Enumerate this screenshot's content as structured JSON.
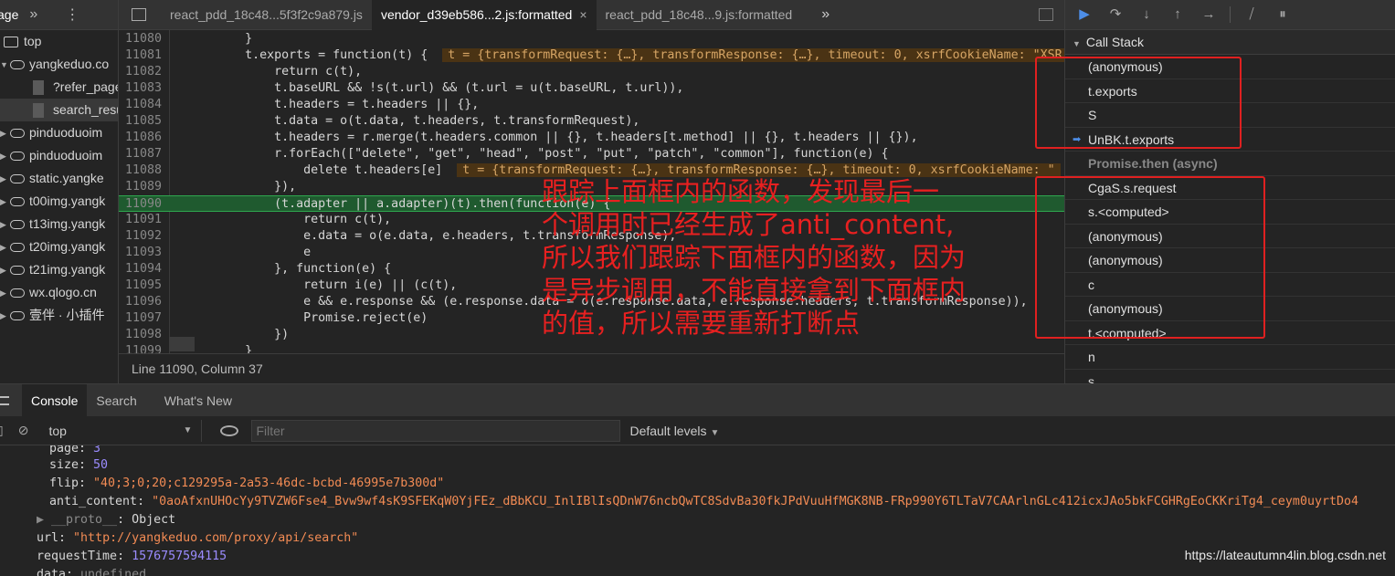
{
  "left_panel": {
    "tab_label": "age",
    "items": [
      {
        "type": "folder",
        "label": "top"
      },
      {
        "type": "cloud",
        "label": "yangkeduo.co",
        "expanded": true
      },
      {
        "type": "file",
        "label": "?refer_page"
      },
      {
        "type": "file",
        "label": "search_resu",
        "selected": true
      },
      {
        "type": "cloud",
        "label": "pinduoduoim"
      },
      {
        "type": "cloud",
        "label": "pinduoduoim"
      },
      {
        "type": "cloud",
        "label": "static.yangke"
      },
      {
        "type": "cloud",
        "label": "t00img.yangk"
      },
      {
        "type": "cloud",
        "label": "t13img.yangk"
      },
      {
        "type": "cloud",
        "label": "t20img.yangk"
      },
      {
        "type": "cloud",
        "label": "t21img.yangk"
      },
      {
        "type": "cloud",
        "label": "wx.qlogo.cn"
      },
      {
        "type": "cloud",
        "label": "壹伴 · 小插件"
      }
    ]
  },
  "file_tabs": [
    {
      "label": "react_pdd_18c48...5f3f2c9a879.js",
      "active": false
    },
    {
      "label": "vendor_d39eb586...2.js:formatted",
      "active": true,
      "close": "×"
    },
    {
      "label": "react_pdd_18c48...9.js:formatted",
      "active": false
    }
  ],
  "editor": {
    "lines": [
      {
        "num": "11080",
        "code": "        }"
      },
      {
        "num": "11081",
        "code": "        t.exports = function(t) {",
        "inline": "t = {transformRequest: {…}, transformResponse: {…}, timeout: 0, xsrfCookieName: \"XSR"
      },
      {
        "num": "11082",
        "code": "            return c(t),"
      },
      {
        "num": "11083",
        "code": "            t.baseURL && !s(t.url) && (t.url = u(t.baseURL, t.url)),"
      },
      {
        "num": "11084",
        "code": "            t.headers = t.headers || {},"
      },
      {
        "num": "11085",
        "code": "            t.data = o(t.data, t.headers, t.transformRequest),"
      },
      {
        "num": "11086",
        "code": "            t.headers = r.merge(t.headers.common || {}, t.headers[t.method] || {}, t.headers || {}),"
      },
      {
        "num": "11087",
        "code": "            r.forEach([\"delete\", \"get\", \"head\", \"post\", \"put\", \"patch\", \"common\"], function(e) {"
      },
      {
        "num": "11088",
        "code": "                delete t.headers[e]",
        "inline": "t = {transformRequest: {…}, transformResponse: {…}, timeout: 0, xsrfCookieName: \""
      },
      {
        "num": "11089",
        "code": "            }),"
      },
      {
        "num": "11090",
        "code": "            (t.adapter || a.adapter)(t).then(function(e) {",
        "highlight": true
      },
      {
        "num": "11091",
        "code": "                return c(t),"
      },
      {
        "num": "11092",
        "code": "                e.data = o(e.data, e.headers, t.transformResponse),"
      },
      {
        "num": "11093",
        "code": "                e"
      },
      {
        "num": "11094",
        "code": "            }, function(e) {"
      },
      {
        "num": "11095",
        "code": "                return i(e) || (c(t),"
      },
      {
        "num": "11096",
        "code": "                e && e.response && (e.response.data = o(e.response.data, e.response.headers, t.transformResponse)),"
      },
      {
        "num": "11097",
        "code": "                Promise.reject(e)"
      },
      {
        "num": "11098",
        "code": "            })"
      },
      {
        "num": "11099",
        "code": "        }"
      }
    ],
    "status": "Line 11090, Column 37"
  },
  "debugger": {
    "call_stack_title": "Call Stack",
    "frames": [
      {
        "label": "(anonymous)"
      },
      {
        "label": "t.exports"
      },
      {
        "label": "S"
      },
      {
        "label": "UnBK.t.exports",
        "current": true
      },
      {
        "label": "Promise.then (async)",
        "async": true
      },
      {
        "label": "CgaS.s.request"
      },
      {
        "label": "s.<computed>"
      },
      {
        "label": "(anonymous)"
      },
      {
        "label": "(anonymous)"
      },
      {
        "label": "c"
      },
      {
        "label": "(anonymous)"
      },
      {
        "label": "t.<computed>"
      },
      {
        "label": "n"
      },
      {
        "label": "s"
      }
    ]
  },
  "annotation": {
    "lines": [
      "跟踪上面框内的函数，发现最后一",
      "个调用时已经生成了anti_content,",
      "所以我们跟踪下面框内的函数，因为",
      "是异步调用，不能直接拿到下面框内",
      "的值，所以需要重新打断点"
    ],
    "color": "#e82020"
  },
  "drawer": {
    "tabs": [
      {
        "label": "Console",
        "active": true
      },
      {
        "label": "Search"
      },
      {
        "label": "What's New"
      }
    ],
    "context": "top",
    "filter_placeholder": "Filter",
    "levels": "Default levels"
  },
  "console": {
    "page_key": "page",
    "page_val": "3",
    "size_key": "size",
    "size_val": "50",
    "flip_key": "flip",
    "flip_val": "\"40;3;0;20;c129295a-2a53-46dc-bcbd-46995e7b300d\"",
    "anti_key": "anti_content",
    "anti_val": "\"0aoAfxnUHOcYy9TVZW6Fse4_Bvw9wf4sK9SFEKqW0YjFEz_dBbKCU_InlIBlIsQDnW76ncbQwTC8SdvBa30fkJPdVuuHfMGK8NB-FRp990Y6TLTaV7CAArlnGLc412icxJAo5bkFCGHRgEoCKKriTg4_ceym0uyrtDo4",
    "proto_key": "__proto__",
    "proto_val": "Object",
    "url_key": "url",
    "url_val": "\"http://yangkeduo.com/proxy/api/search\"",
    "rt_key": "requestTime",
    "rt_val": "1576757594115",
    "data_key": "data",
    "data_val": "undefined"
  },
  "watermark": "https://lateautumn4lin.blog.csdn.net"
}
